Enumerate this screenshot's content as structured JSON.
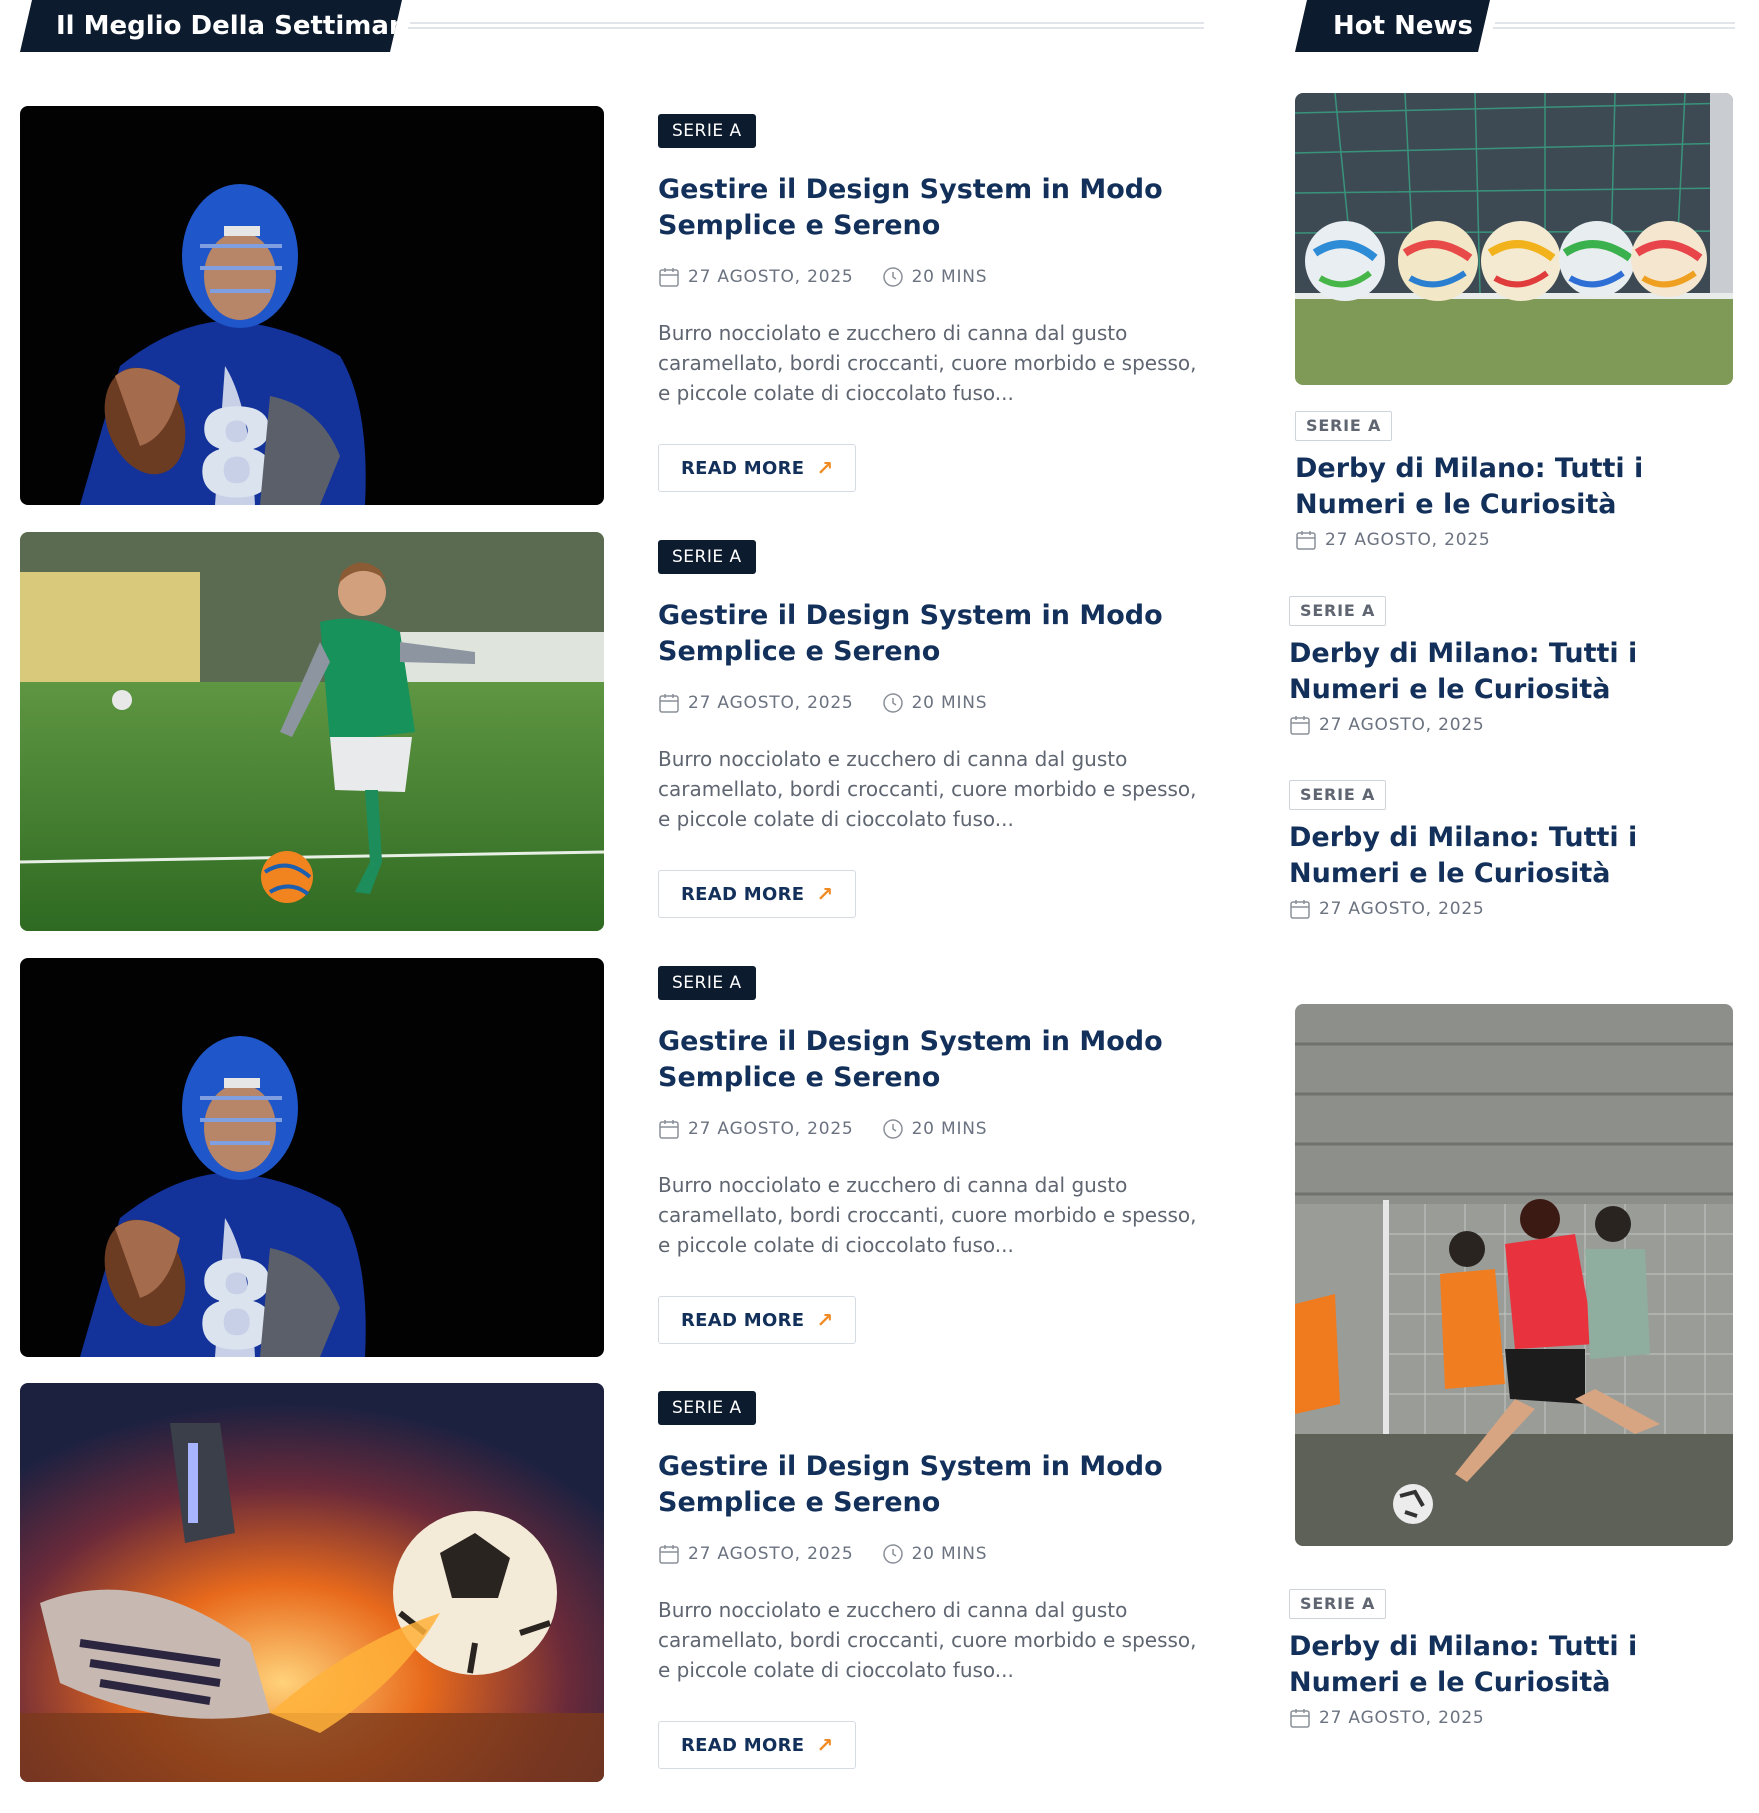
{
  "main_section": {
    "title": "Il Meglio Della Settimana"
  },
  "side_section": {
    "title": "Hot News"
  },
  "articles": [
    {
      "category": "SERIE A",
      "title": "Gestire il Design System in Modo Semplice e Sereno",
      "date": "27 AGOSTO, 2025",
      "read_time": "20 MINS",
      "excerpt": "Burro nocciolato e zucchero di canna dal gusto caramellato, bordi croccanti, cuore morbido e spesso, e piccole colate di cioccolato fuso...",
      "button_label": "READ MORE",
      "image": "american-football-player"
    },
    {
      "category": "SERIE A",
      "title": "Gestire il Design System in Modo Semplice e Sereno",
      "date": "27 AGOSTO, 2025",
      "read_time": "20 MINS",
      "excerpt": "Burro nocciolato e zucchero di canna dal gusto caramellato, bordi croccanti, cuore morbido e spesso, e piccole colate di cioccolato fuso...",
      "button_label": "READ MORE",
      "image": "child-kicking-ball"
    },
    {
      "category": "SERIE A",
      "title": "Gestire il Design System in Modo Semplice e Sereno",
      "date": "27 AGOSTO, 2025",
      "read_time": "20 MINS",
      "excerpt": "Burro nocciolato e zucchero di canna dal gusto caramellato, bordi croccanti, cuore morbido e spesso, e piccole colate di cioccolato fuso...",
      "button_label": "READ MORE",
      "image": "american-football-player"
    },
    {
      "category": "SERIE A",
      "title": "Gestire il Design System in Modo Semplice e Sereno",
      "date": "27 AGOSTO, 2025",
      "read_time": "20 MINS",
      "excerpt": "Burro nocciolato e zucchero di canna dal gusto caramellato, bordi croccanti, cuore morbido e spesso, e piccole colate di cioccolato fuso...",
      "button_label": "READ MORE",
      "image": "fiery-ball-kick"
    }
  ],
  "hot_news": [
    {
      "category": "SERIE A",
      "title": "Derby di Milano: Tutti i Numeri e le Curiosità",
      "date": "27 AGOSTO, 2025"
    },
    {
      "category": "SERIE A",
      "title": "Derby di Milano: Tutti i Numeri e le Curiosità",
      "date": "27 AGOSTO, 2025"
    },
    {
      "category": "SERIE A",
      "title": "Derby di Milano: Tutti i Numeri e le Curiosità",
      "date": "27 AGOSTO, 2025"
    },
    {
      "category": "SERIE A",
      "title": "Derby di Milano: Tutti i Numeri e le Curiosità",
      "date": "27 AGOSTO, 2025"
    }
  ],
  "hot_news_images": [
    "soccer-balls-by-goal",
    "street-football-match"
  ],
  "icons": {
    "date": "calendar-icon",
    "time": "clock-icon",
    "button": "arrow-up-right-icon"
  },
  "colors": {
    "navy": "#0d1b2e",
    "title": "#12305a",
    "accent": "#f08a24",
    "muted": "#6b7280"
  }
}
